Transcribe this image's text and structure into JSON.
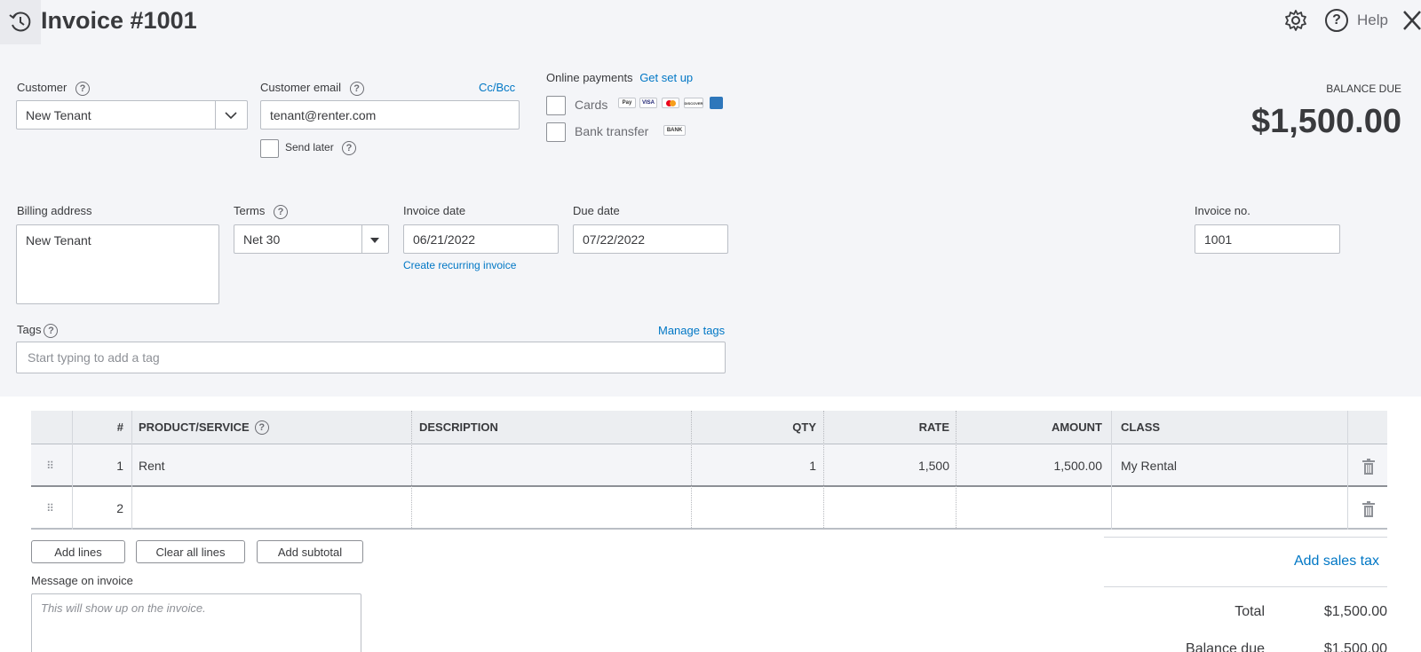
{
  "header": {
    "title": "Invoice #1001",
    "help_label": "Help"
  },
  "customer": {
    "label": "Customer",
    "value": "New Tenant"
  },
  "email": {
    "label": "Customer email",
    "value": "tenant@renter.com",
    "cc_bcc": "Cc/Bcc",
    "send_later": "Send later"
  },
  "payments": {
    "label": "Online payments",
    "setup_link": "Get set up",
    "cards_label": "Cards",
    "bank_label": "Bank transfer",
    "card_icons": [
      "apple-pay-icon",
      "visa-icon",
      "mastercard-icon",
      "discover-icon",
      "amex-icon"
    ],
    "card_icon_texts": [
      "Pay",
      "VISA",
      "",
      "DISCOVER",
      ""
    ],
    "bank_icon_text": "BANK"
  },
  "balance": {
    "label": "BALANCE DUE",
    "amount": "$1,500.00"
  },
  "billing": {
    "label": "Billing address",
    "value": "New Tenant"
  },
  "terms": {
    "label": "Terms",
    "value": "Net 30"
  },
  "invoice_date": {
    "label": "Invoice date",
    "value": "06/21/2022",
    "recurring_link": "Create recurring invoice"
  },
  "due_date": {
    "label": "Due date",
    "value": "07/22/2022"
  },
  "invoice_no": {
    "label": "Invoice no.",
    "value": "1001"
  },
  "tags": {
    "label": "Tags",
    "manage_link": "Manage tags",
    "placeholder": "Start typing to add a tag"
  },
  "table": {
    "headers": {
      "num": "#",
      "product": "PRODUCT/SERVICE",
      "description": "DESCRIPTION",
      "qty": "QTY",
      "rate": "RATE",
      "amount": "AMOUNT",
      "class": "CLASS"
    },
    "rows": [
      {
        "num": "1",
        "product": "Rent",
        "description": "",
        "qty": "1",
        "rate": "1,500",
        "amount": "1,500.00",
        "class": "My Rental"
      },
      {
        "num": "2",
        "product": "",
        "description": "",
        "qty": "",
        "rate": "",
        "amount": "",
        "class": ""
      }
    ]
  },
  "actions": {
    "add_lines": "Add lines",
    "clear_lines": "Clear all lines",
    "add_subtotal": "Add subtotal"
  },
  "message": {
    "label": "Message on invoice",
    "placeholder": "This will show up on the invoice."
  },
  "totals": {
    "add_sales_tax": "Add sales tax",
    "total_label": "Total",
    "total_value": "$1,500.00",
    "balance_label": "Balance due",
    "balance_value": "$1,500.00"
  },
  "colors": {
    "accent": "#0077c5",
    "panel_bg": "#f4f5f8",
    "text": "#393a3d"
  }
}
